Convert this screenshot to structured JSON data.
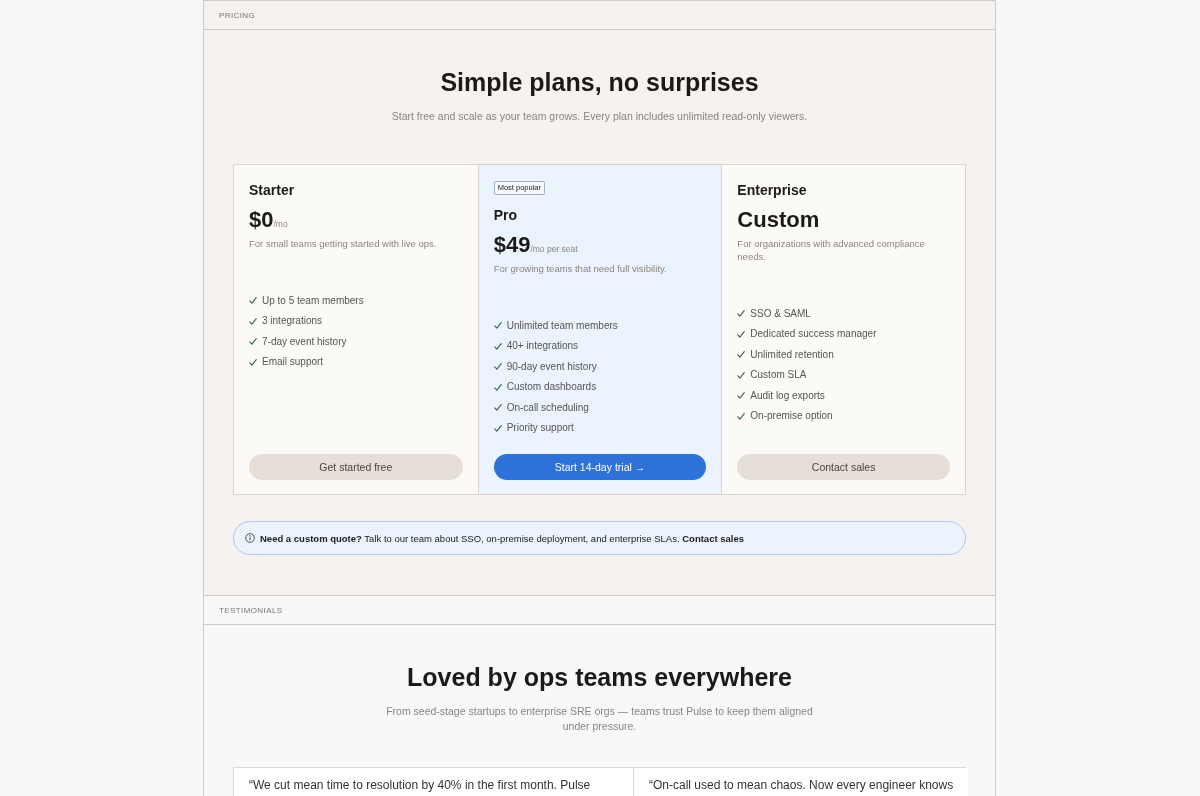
{
  "pricing": {
    "section_label": "PRICING",
    "title": "Simple plans, no surprises",
    "subtitle": "Start free and scale as your team grows. Every plan includes unlimited read-only viewers.",
    "plans": [
      {
        "name": "Starter",
        "highlighted": false,
        "price": "$0",
        "period": "/mo",
        "description": "For small teams getting started with live ops.",
        "features": [
          "Up to 5 team members",
          "3 integrations",
          "7-day event history",
          "Email support"
        ],
        "cta": "Get started free"
      },
      {
        "name": "Pro",
        "badge": "Most popular",
        "highlighted": true,
        "price": "$49",
        "period": "/mo per seat",
        "description": "For growing teams that need full visibility.",
        "features": [
          "Unlimited team members",
          "40+ integrations",
          "90-day event history",
          "Custom dashboards",
          "On-call scheduling",
          "Priority support"
        ],
        "cta": "Start 14-day trial →"
      },
      {
        "name": "Enterprise",
        "highlighted": false,
        "price": "Custom",
        "description": "For organizations with advanced compliance needs.",
        "features": [
          "SSO & SAML",
          "Dedicated success manager",
          "Unlimited retention",
          "Custom SLA",
          "Audit log exports",
          "On-premise option"
        ],
        "cta": "Contact sales"
      }
    ],
    "callout": {
      "text": "**Need a custom quote?** Talk to our team about SSO, on-premise deployment, and enterprise SLAs.",
      "link": "Contact sales"
    }
  },
  "testimonials": {
    "section_label": "TESTIMONIALS",
    "title": "Loved by ops teams everywhere",
    "subtitle": "From seed-stage startups to enterprise SRE orgs — teams trust Pulse to keep them aligned under pressure.",
    "quotes": [
      "“We cut mean time to resolution by 40% in the first month. Pulse",
      "“On-call used to mean chaos. Now every engineer knows"
    ]
  }
}
